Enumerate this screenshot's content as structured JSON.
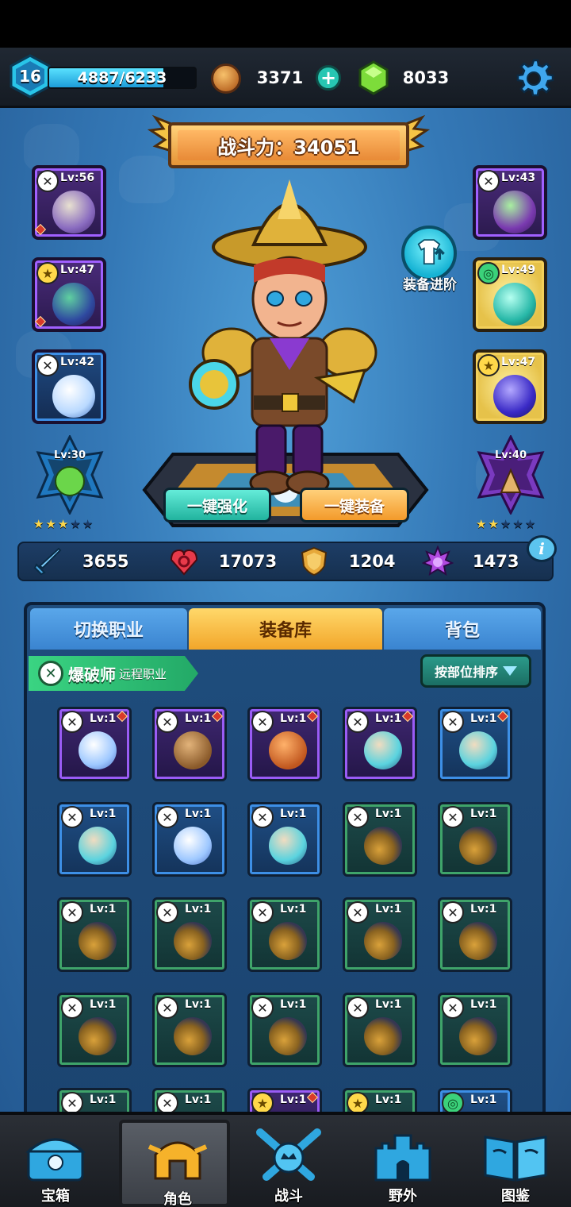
{
  "player": {
    "level": "16",
    "xp": "4887/6233",
    "xp_fraction": 0.784
  },
  "currency": {
    "coins": "3371",
    "gems": "8033"
  },
  "power": {
    "label": "战斗力：34051"
  },
  "upgrade": {
    "label": "装备进阶"
  },
  "left_slots": [
    {
      "level": "Lv:56",
      "rarity": "purple",
      "badge": "x"
    },
    {
      "level": "Lv:47",
      "rarity": "purple",
      "badge": "star"
    },
    {
      "level": "Lv:42",
      "rarity": "blue",
      "badge": "x"
    }
  ],
  "right_slots": [
    {
      "level": "Lv:43",
      "rarity": "purple",
      "badge": "x"
    },
    {
      "level": "Lv:49",
      "rarity": "gold",
      "badge": "green"
    },
    {
      "level": "Lv:47",
      "rarity": "gold",
      "badge": "star"
    }
  ],
  "runes": {
    "left": {
      "level": "Lv:30",
      "stars": 3,
      "max_stars": 5
    },
    "right": {
      "level": "Lv:40",
      "stars": 2,
      "max_stars": 5
    }
  },
  "actions": {
    "enhance": "一键强化",
    "equip": "一键装备"
  },
  "stats": {
    "attack": "3655",
    "health": "17073",
    "defense": "1204",
    "crit": "1473"
  },
  "tabs": {
    "switch_class": "切换职业",
    "armory": "装备库",
    "backpack": "背包"
  },
  "class_info": {
    "name": "爆破师",
    "type": "远程职业"
  },
  "sort_button": "按部位排序",
  "grid_items": [
    {
      "level": "Lv:1",
      "rarity": "purple",
      "art": "cross",
      "badge": "x"
    },
    {
      "level": "Lv:1",
      "rarity": "purple",
      "art": "brown",
      "badge": "x"
    },
    {
      "level": "Lv:1",
      "rarity": "purple",
      "art": "orange",
      "badge": "x"
    },
    {
      "level": "Lv:1",
      "rarity": "purple",
      "art": "teal",
      "badge": "x"
    },
    {
      "level": "Lv:1",
      "rarity": "blue",
      "art": "teal",
      "badge": "x"
    },
    {
      "level": "Lv:1",
      "rarity": "blue",
      "art": "teal",
      "badge": "x"
    },
    {
      "level": "Lv:1",
      "rarity": "blue",
      "art": "cross",
      "badge": "x"
    },
    {
      "level": "Lv:1",
      "rarity": "blue",
      "art": "teal",
      "badge": "x"
    },
    {
      "level": "Lv:1",
      "rarity": "green",
      "art": "gold",
      "badge": "x"
    },
    {
      "level": "Lv:1",
      "rarity": "green",
      "art": "gold",
      "badge": "x"
    },
    {
      "level": "Lv:1",
      "rarity": "green",
      "art": "gold",
      "badge": "x"
    },
    {
      "level": "Lv:1",
      "rarity": "green",
      "art": "gold",
      "badge": "x"
    },
    {
      "level": "Lv:1",
      "rarity": "green",
      "art": "gold",
      "badge": "x"
    },
    {
      "level": "Lv:1",
      "rarity": "green",
      "art": "gold",
      "badge": "x"
    },
    {
      "level": "Lv:1",
      "rarity": "green",
      "art": "gold",
      "badge": "x"
    },
    {
      "level": "Lv:1",
      "rarity": "green",
      "art": "gold",
      "badge": "x"
    },
    {
      "level": "Lv:1",
      "rarity": "green",
      "art": "gold",
      "badge": "x"
    },
    {
      "level": "Lv:1",
      "rarity": "green",
      "art": "gold",
      "badge": "x"
    },
    {
      "level": "Lv:1",
      "rarity": "green",
      "art": "gold",
      "badge": "x"
    },
    {
      "level": "Lv:1",
      "rarity": "green",
      "art": "gold",
      "badge": "x"
    },
    {
      "level": "Lv:1",
      "rarity": "green",
      "art": "gold",
      "badge": "x"
    },
    {
      "level": "Lv:1",
      "rarity": "green",
      "art": "gold",
      "badge": "x"
    },
    {
      "level": "Lv:1",
      "rarity": "purple",
      "art": "dark",
      "badge": "star"
    },
    {
      "level": "Lv:1",
      "rarity": "green",
      "art": "dark",
      "badge": "star"
    },
    {
      "level": "Lv:1",
      "rarity": "blue",
      "art": "dark",
      "badge": "green"
    }
  ],
  "nav": [
    {
      "label": "宝箱",
      "icon": "chest-icon"
    },
    {
      "label": "角色",
      "icon": "helmet-icon"
    },
    {
      "label": "战斗",
      "icon": "crossed-swords-icon"
    },
    {
      "label": "野外",
      "icon": "castle-icon"
    },
    {
      "label": "图鉴",
      "icon": "book-icon"
    }
  ],
  "colors": {
    "panel": "#1f4d7d",
    "tab_active": "#f2a62a",
    "tab_inactive": "#3a84d0",
    "xp_fill": "#1d9dd8"
  }
}
